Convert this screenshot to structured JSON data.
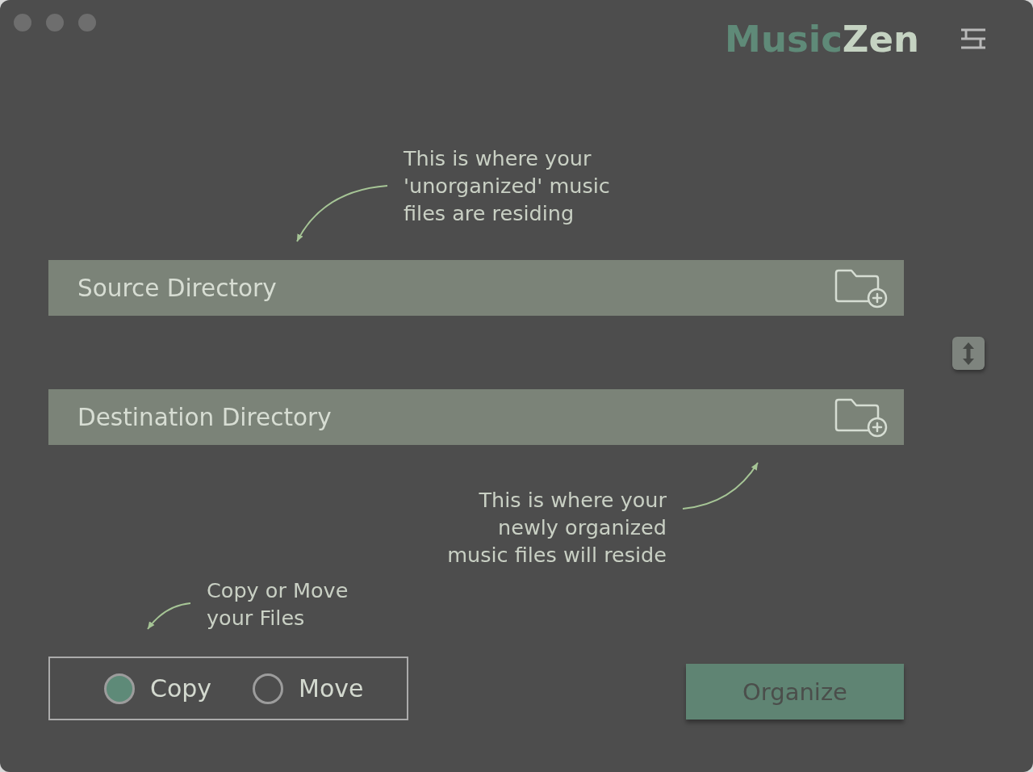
{
  "title_bar": {
    "logo": [
      "Music",
      "Zen"
    ]
  },
  "source": {
    "hint": [
      "This is where your",
      "'unorganized' music",
      "files are residing"
    ],
    "placeholder": "Source Directory"
  },
  "destination": {
    "placeholder": "Destination Directory",
    "hint": [
      "This is where your",
      "newly organized",
      "music files will reside"
    ]
  },
  "transfer_mode": {
    "hint": [
      "Copy or Move",
      "your Files"
    ],
    "options": [
      {
        "label": "Copy",
        "selected": true
      },
      {
        "label": "Move",
        "selected": false
      }
    ]
  },
  "organize_button": {
    "label": "Organize"
  }
}
